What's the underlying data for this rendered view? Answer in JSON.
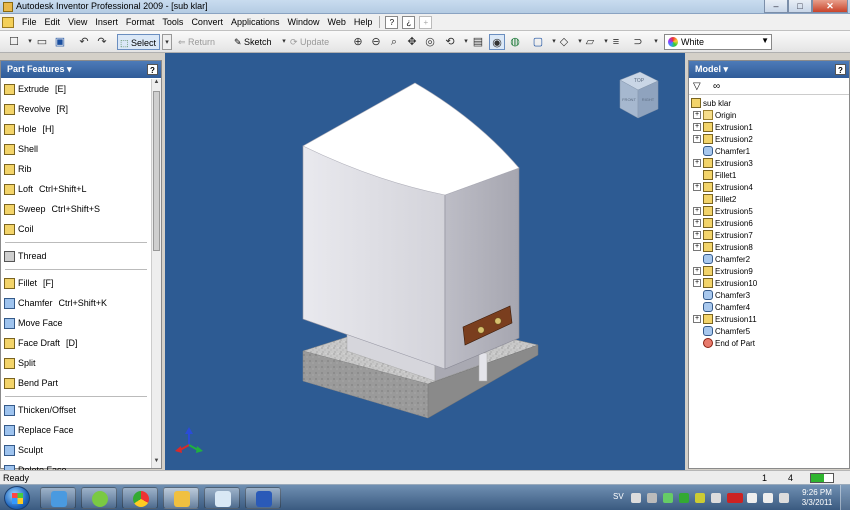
{
  "window": {
    "title": "Autodesk Inventor Professional 2009 - [sub klar]",
    "minimize": "–",
    "maximize": "□",
    "close": "✕"
  },
  "menu": [
    "File",
    "Edit",
    "View",
    "Insert",
    "Format",
    "Tools",
    "Convert",
    "Applications",
    "Window",
    "Web",
    "Help"
  ],
  "toolbar": {
    "select_label": "Select",
    "return_label": "Return",
    "sketch_label": "Sketch",
    "update_label": "Update",
    "color_value": "White"
  },
  "left_panel": {
    "title": "Part Features",
    "group1": [
      {
        "label": "Extrude",
        "shortcut": "[E]"
      },
      {
        "label": "Revolve",
        "shortcut": "[R]"
      },
      {
        "label": "Hole",
        "shortcut": "[H]"
      },
      {
        "label": "Shell",
        "shortcut": ""
      },
      {
        "label": "Rib",
        "shortcut": ""
      },
      {
        "label": "Loft",
        "shortcut": "Ctrl+Shift+L"
      },
      {
        "label": "Sweep",
        "shortcut": "Ctrl+Shift+S"
      },
      {
        "label": "Coil",
        "shortcut": ""
      }
    ],
    "group2": [
      {
        "label": "Thread",
        "shortcut": ""
      }
    ],
    "group3": [
      {
        "label": "Fillet",
        "shortcut": "[F]"
      },
      {
        "label": "Chamfer",
        "shortcut": "Ctrl+Shift+K"
      },
      {
        "label": "Move Face",
        "shortcut": ""
      },
      {
        "label": "Face Draft",
        "shortcut": "[D]"
      },
      {
        "label": "Split",
        "shortcut": ""
      },
      {
        "label": "Bend Part",
        "shortcut": ""
      }
    ],
    "group4": [
      {
        "label": "Thicken/Offset",
        "shortcut": ""
      },
      {
        "label": "Replace Face",
        "shortcut": ""
      },
      {
        "label": "Sculpt",
        "shortcut": ""
      },
      {
        "label": "Delete Face",
        "shortcut": ""
      }
    ]
  },
  "right_panel": {
    "title": "Model",
    "tree": [
      {
        "label": "sub klar",
        "icon": "part",
        "expandable": false,
        "indent": 0
      },
      {
        "label": "Origin",
        "icon": "folder",
        "expandable": true,
        "indent": 1
      },
      {
        "label": "Extrusion1",
        "icon": "feature",
        "expandable": true,
        "indent": 1
      },
      {
        "label": "Extrusion2",
        "icon": "feature",
        "expandable": true,
        "indent": 1
      },
      {
        "label": "Chamfer1",
        "icon": "blue",
        "expandable": false,
        "indent": 1
      },
      {
        "label": "Extrusion3",
        "icon": "feature",
        "expandable": true,
        "indent": 1
      },
      {
        "label": "Fillet1",
        "icon": "feature",
        "expandable": false,
        "indent": 1
      },
      {
        "label": "Extrusion4",
        "icon": "feature",
        "expandable": true,
        "indent": 1
      },
      {
        "label": "Fillet2",
        "icon": "feature",
        "expandable": false,
        "indent": 1
      },
      {
        "label": "Extrusion5",
        "icon": "feature",
        "expandable": true,
        "indent": 1
      },
      {
        "label": "Extrusion6",
        "icon": "feature",
        "expandable": true,
        "indent": 1
      },
      {
        "label": "Extrusion7",
        "icon": "feature",
        "expandable": true,
        "indent": 1
      },
      {
        "label": "Extrusion8",
        "icon": "feature",
        "expandable": true,
        "indent": 1
      },
      {
        "label": "Chamfer2",
        "icon": "blue",
        "expandable": false,
        "indent": 1
      },
      {
        "label": "Extrusion9",
        "icon": "feature",
        "expandable": true,
        "indent": 1
      },
      {
        "label": "Extrusion10",
        "icon": "feature",
        "expandable": true,
        "indent": 1
      },
      {
        "label": "Chamfer3",
        "icon": "blue",
        "expandable": false,
        "indent": 1
      },
      {
        "label": "Chamfer4",
        "icon": "blue",
        "expandable": false,
        "indent": 1
      },
      {
        "label": "Extrusion11",
        "icon": "feature",
        "expandable": true,
        "indent": 1
      },
      {
        "label": "Chamfer5",
        "icon": "blue",
        "expandable": false,
        "indent": 1
      },
      {
        "label": "End of Part",
        "icon": "end",
        "expandable": false,
        "indent": 1
      }
    ]
  },
  "viewcube": {
    "front": "FRONT",
    "right": "RIGHT",
    "top": "TOP"
  },
  "status": {
    "text": "Ready",
    "n1": "1",
    "n2": "4"
  },
  "taskbar": {
    "lang": "SV",
    "time": "9:26 PM",
    "date": "3/3/2011"
  },
  "colors": {
    "viewport_bg": "#2d5b93",
    "panel_header": "#3a68a8"
  }
}
